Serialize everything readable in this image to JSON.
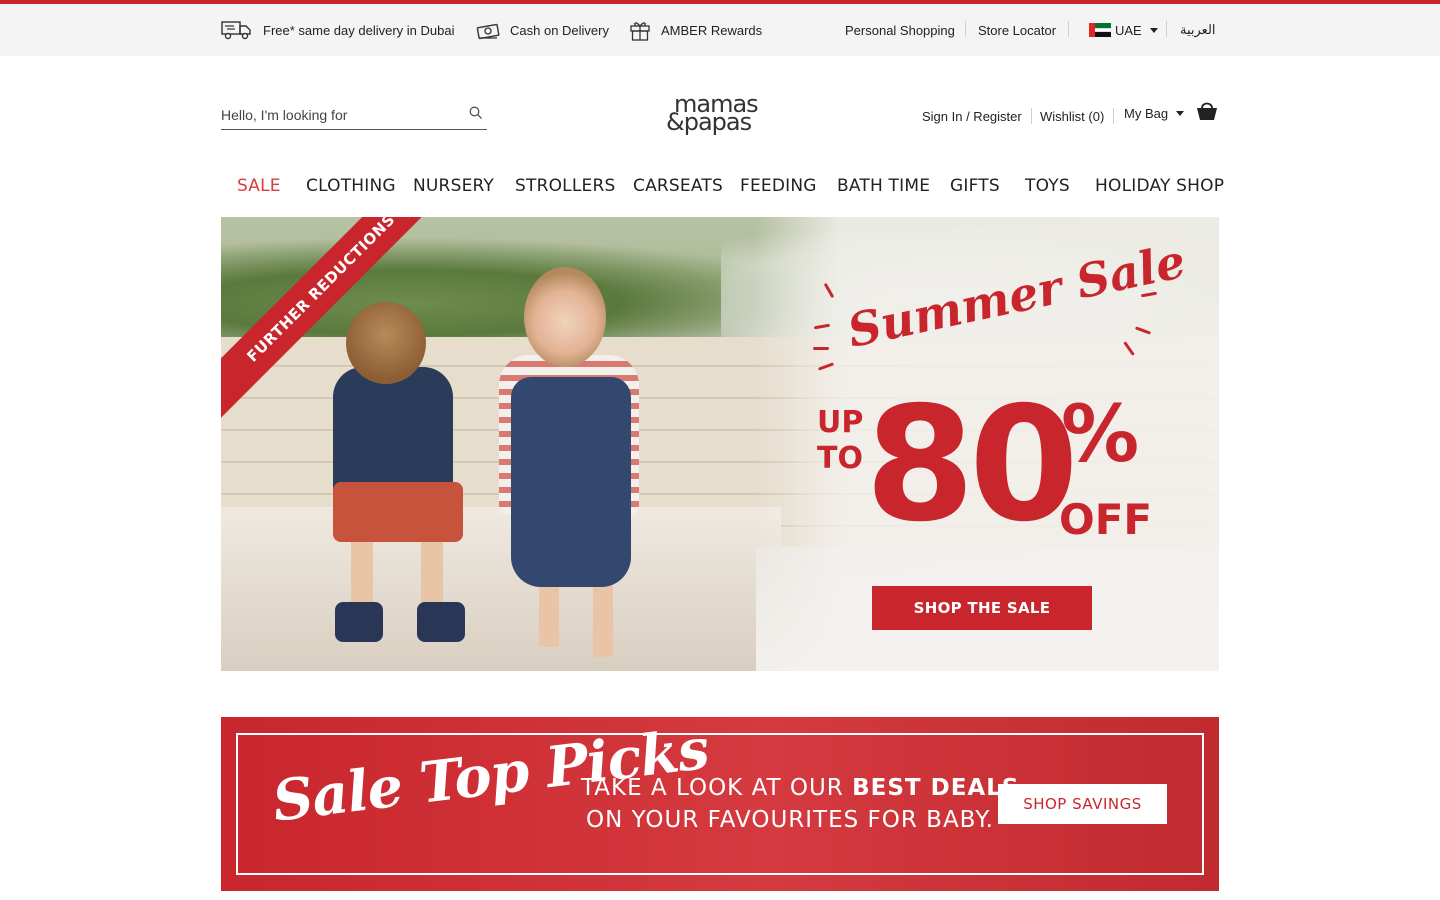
{
  "colors": {
    "brand_red": "#c8262c",
    "sale_red": "#d93b3f",
    "topbar_bg": "#f4f4f4"
  },
  "topbar": {
    "delivery": "Free* same day delivery in Dubai",
    "cod": "Cash on Delivery",
    "rewards": "AMBER Rewards",
    "personal_shopping": "Personal Shopping",
    "store_locator": "Store Locator",
    "country": "UAE",
    "language": "العربية"
  },
  "header": {
    "search_placeholder": "Hello, I'm looking for",
    "logo_line1": "mamas",
    "logo_line2": "&papas",
    "sign_in": "Sign In / Register",
    "wishlist": "Wishlist (0)",
    "bag": "My Bag"
  },
  "nav": {
    "items": [
      "SALE",
      "CLOTHING",
      "NURSERY",
      "STROLLERS",
      "CARSEATS",
      "FEEDING",
      "BATH TIME",
      "GIFTS",
      "TOYS",
      "HOLIDAY SHOP"
    ]
  },
  "hero": {
    "ribbon": "FURTHER REDUCTIONS",
    "headline": "Summer Sale",
    "up": "UP",
    "to": "TO",
    "amount": "80",
    "percent": "%",
    "off": "OFF",
    "cta": "SHOP THE SALE"
  },
  "promo": {
    "script": "Sale Top Picks",
    "line1_a": "TAKE A LOOK AT OUR ",
    "line1_b": "BEST DEALS",
    "line2": "ON YOUR FAVOURITES FOR BABY.",
    "cta": "SHOP SAVINGS"
  }
}
